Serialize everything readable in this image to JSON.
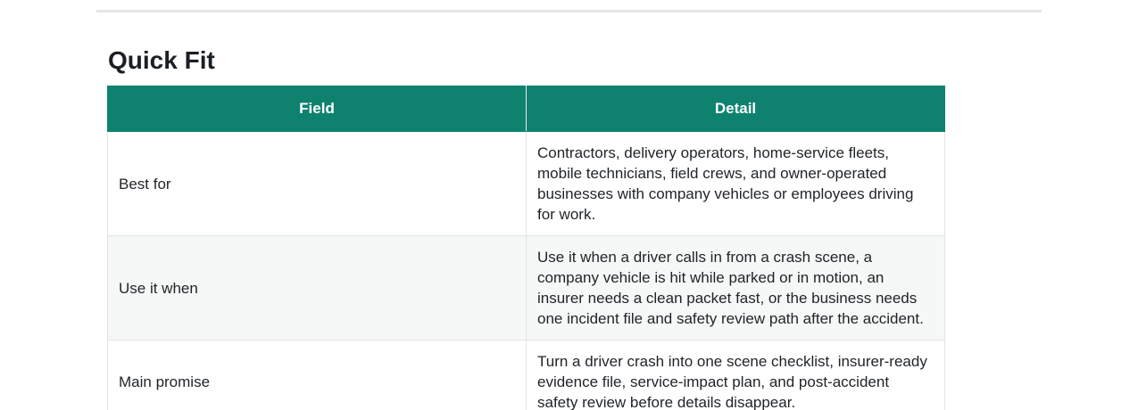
{
  "section": {
    "title": "Quick Fit"
  },
  "table": {
    "headers": {
      "field": "Field",
      "detail": "Detail"
    },
    "rows": [
      {
        "field": "Best for",
        "detail": "Contractors, delivery operators, home-service fleets, mobile technicians, field crews, and owner-operated businesses with company vehicles or employees driving for work."
      },
      {
        "field": "Use it when",
        "detail": "Use it when a driver calls in from a crash scene, a company vehicle is hit while parked or in motion, an insurer needs a clean packet fast, or the business needs one incident file and safety review path after the accident."
      },
      {
        "field": "Main promise",
        "detail": "Turn a driver crash into one scene checklist, insurer-ready evidence file, service-impact plan, and post-accident safety review before details disappear."
      }
    ]
  },
  "colors": {
    "header_bg": "#0e826f",
    "header_text": "#ffffff",
    "alt_row_bg": "#f6f8f7"
  }
}
